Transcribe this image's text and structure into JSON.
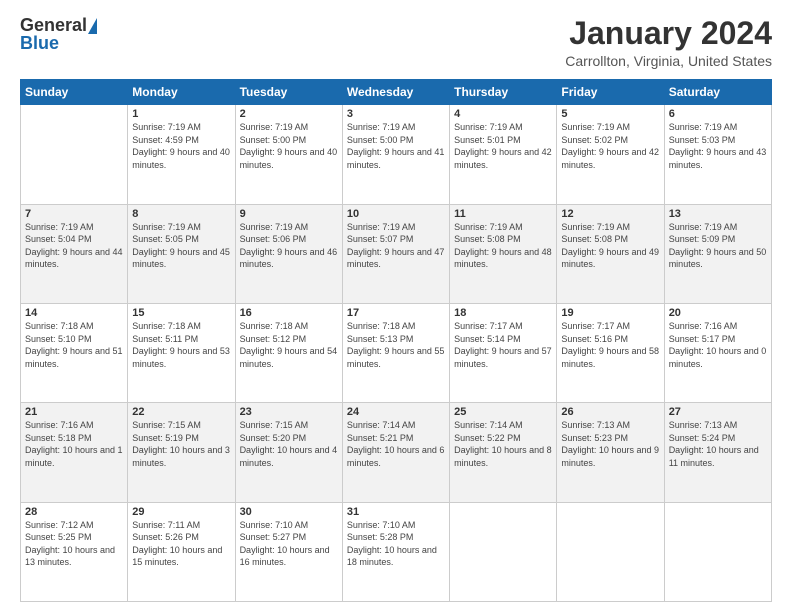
{
  "header": {
    "logo_general": "General",
    "logo_blue": "Blue",
    "title": "January 2024",
    "location": "Carrollton, Virginia, United States"
  },
  "calendar": {
    "days_of_week": [
      "Sunday",
      "Monday",
      "Tuesday",
      "Wednesday",
      "Thursday",
      "Friday",
      "Saturday"
    ],
    "weeks": [
      [
        {
          "day": "",
          "sunrise": "",
          "sunset": "",
          "daylight": ""
        },
        {
          "day": "1",
          "sunrise": "Sunrise: 7:19 AM",
          "sunset": "Sunset: 4:59 PM",
          "daylight": "Daylight: 9 hours and 40 minutes."
        },
        {
          "day": "2",
          "sunrise": "Sunrise: 7:19 AM",
          "sunset": "Sunset: 5:00 PM",
          "daylight": "Daylight: 9 hours and 40 minutes."
        },
        {
          "day": "3",
          "sunrise": "Sunrise: 7:19 AM",
          "sunset": "Sunset: 5:00 PM",
          "daylight": "Daylight: 9 hours and 41 minutes."
        },
        {
          "day": "4",
          "sunrise": "Sunrise: 7:19 AM",
          "sunset": "Sunset: 5:01 PM",
          "daylight": "Daylight: 9 hours and 42 minutes."
        },
        {
          "day": "5",
          "sunrise": "Sunrise: 7:19 AM",
          "sunset": "Sunset: 5:02 PM",
          "daylight": "Daylight: 9 hours and 42 minutes."
        },
        {
          "day": "6",
          "sunrise": "Sunrise: 7:19 AM",
          "sunset": "Sunset: 5:03 PM",
          "daylight": "Daylight: 9 hours and 43 minutes."
        }
      ],
      [
        {
          "day": "7",
          "sunrise": "Sunrise: 7:19 AM",
          "sunset": "Sunset: 5:04 PM",
          "daylight": "Daylight: 9 hours and 44 minutes."
        },
        {
          "day": "8",
          "sunrise": "Sunrise: 7:19 AM",
          "sunset": "Sunset: 5:05 PM",
          "daylight": "Daylight: 9 hours and 45 minutes."
        },
        {
          "day": "9",
          "sunrise": "Sunrise: 7:19 AM",
          "sunset": "Sunset: 5:06 PM",
          "daylight": "Daylight: 9 hours and 46 minutes."
        },
        {
          "day": "10",
          "sunrise": "Sunrise: 7:19 AM",
          "sunset": "Sunset: 5:07 PM",
          "daylight": "Daylight: 9 hours and 47 minutes."
        },
        {
          "day": "11",
          "sunrise": "Sunrise: 7:19 AM",
          "sunset": "Sunset: 5:08 PM",
          "daylight": "Daylight: 9 hours and 48 minutes."
        },
        {
          "day": "12",
          "sunrise": "Sunrise: 7:19 AM",
          "sunset": "Sunset: 5:08 PM",
          "daylight": "Daylight: 9 hours and 49 minutes."
        },
        {
          "day": "13",
          "sunrise": "Sunrise: 7:19 AM",
          "sunset": "Sunset: 5:09 PM",
          "daylight": "Daylight: 9 hours and 50 minutes."
        }
      ],
      [
        {
          "day": "14",
          "sunrise": "Sunrise: 7:18 AM",
          "sunset": "Sunset: 5:10 PM",
          "daylight": "Daylight: 9 hours and 51 minutes."
        },
        {
          "day": "15",
          "sunrise": "Sunrise: 7:18 AM",
          "sunset": "Sunset: 5:11 PM",
          "daylight": "Daylight: 9 hours and 53 minutes."
        },
        {
          "day": "16",
          "sunrise": "Sunrise: 7:18 AM",
          "sunset": "Sunset: 5:12 PM",
          "daylight": "Daylight: 9 hours and 54 minutes."
        },
        {
          "day": "17",
          "sunrise": "Sunrise: 7:18 AM",
          "sunset": "Sunset: 5:13 PM",
          "daylight": "Daylight: 9 hours and 55 minutes."
        },
        {
          "day": "18",
          "sunrise": "Sunrise: 7:17 AM",
          "sunset": "Sunset: 5:14 PM",
          "daylight": "Daylight: 9 hours and 57 minutes."
        },
        {
          "day": "19",
          "sunrise": "Sunrise: 7:17 AM",
          "sunset": "Sunset: 5:16 PM",
          "daylight": "Daylight: 9 hours and 58 minutes."
        },
        {
          "day": "20",
          "sunrise": "Sunrise: 7:16 AM",
          "sunset": "Sunset: 5:17 PM",
          "daylight": "Daylight: 10 hours and 0 minutes."
        }
      ],
      [
        {
          "day": "21",
          "sunrise": "Sunrise: 7:16 AM",
          "sunset": "Sunset: 5:18 PM",
          "daylight": "Daylight: 10 hours and 1 minute."
        },
        {
          "day": "22",
          "sunrise": "Sunrise: 7:15 AM",
          "sunset": "Sunset: 5:19 PM",
          "daylight": "Daylight: 10 hours and 3 minutes."
        },
        {
          "day": "23",
          "sunrise": "Sunrise: 7:15 AM",
          "sunset": "Sunset: 5:20 PM",
          "daylight": "Daylight: 10 hours and 4 minutes."
        },
        {
          "day": "24",
          "sunrise": "Sunrise: 7:14 AM",
          "sunset": "Sunset: 5:21 PM",
          "daylight": "Daylight: 10 hours and 6 minutes."
        },
        {
          "day": "25",
          "sunrise": "Sunrise: 7:14 AM",
          "sunset": "Sunset: 5:22 PM",
          "daylight": "Daylight: 10 hours and 8 minutes."
        },
        {
          "day": "26",
          "sunrise": "Sunrise: 7:13 AM",
          "sunset": "Sunset: 5:23 PM",
          "daylight": "Daylight: 10 hours and 9 minutes."
        },
        {
          "day": "27",
          "sunrise": "Sunrise: 7:13 AM",
          "sunset": "Sunset: 5:24 PM",
          "daylight": "Daylight: 10 hours and 11 minutes."
        }
      ],
      [
        {
          "day": "28",
          "sunrise": "Sunrise: 7:12 AM",
          "sunset": "Sunset: 5:25 PM",
          "daylight": "Daylight: 10 hours and 13 minutes."
        },
        {
          "day": "29",
          "sunrise": "Sunrise: 7:11 AM",
          "sunset": "Sunset: 5:26 PM",
          "daylight": "Daylight: 10 hours and 15 minutes."
        },
        {
          "day": "30",
          "sunrise": "Sunrise: 7:10 AM",
          "sunset": "Sunset: 5:27 PM",
          "daylight": "Daylight: 10 hours and 16 minutes."
        },
        {
          "day": "31",
          "sunrise": "Sunrise: 7:10 AM",
          "sunset": "Sunset: 5:28 PM",
          "daylight": "Daylight: 10 hours and 18 minutes."
        },
        {
          "day": "",
          "sunrise": "",
          "sunset": "",
          "daylight": ""
        },
        {
          "day": "",
          "sunrise": "",
          "sunset": "",
          "daylight": ""
        },
        {
          "day": "",
          "sunrise": "",
          "sunset": "",
          "daylight": ""
        }
      ]
    ]
  }
}
